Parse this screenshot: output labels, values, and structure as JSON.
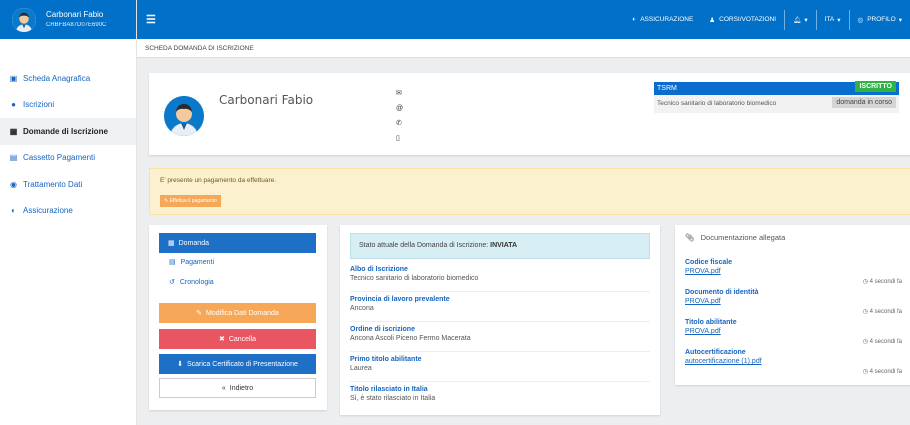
{
  "user": {
    "name": "Carbonari Fabio",
    "code": "CRBFBA87D07E690C"
  },
  "sidebar": {
    "items": [
      {
        "label": "Scheda Anagrafica",
        "icon": "id-card-icon"
      },
      {
        "label": "Iscrizioni",
        "icon": "user-icon"
      },
      {
        "label": "Domande di Iscrizione",
        "icon": "calendar-icon",
        "active": true
      },
      {
        "label": "Cassetto Pagamenti",
        "icon": "file-icon"
      },
      {
        "label": "Trattamento Dati",
        "icon": "eye-icon"
      },
      {
        "label": "Assicurazione",
        "icon": "shield-icon"
      }
    ]
  },
  "topbar": {
    "assicurazione": "ASSICURAZIONE",
    "corsi": "CORSI/VOTAZIONI",
    "language": "ITA",
    "profilo": "PROFILO"
  },
  "breadcrumb": "SCHEDA DOMANDA DI ISCRIZIONE",
  "profile": {
    "name": "Carbonari Fabio",
    "profession_code": "TSRM",
    "profession": "Tecnico sanitario di laboratorio biomedico",
    "status_badge": "ISCRITTO",
    "request_badge": "domanda in corso"
  },
  "alert": {
    "message": "E' presente un pagamento da effettuare.",
    "button": "Effettua il pagamento"
  },
  "left_menu": {
    "domanda": "Domanda",
    "pagamenti": "Pagamenti",
    "cronologia": "Cronologia",
    "modifica": "Modifica Dati Domanda",
    "cancella": "Cancella",
    "scarica": "Scarica Certificato di Presentazione",
    "indietro": "Indietro"
  },
  "details": {
    "status_prefix": "Stato attuale della Domanda di Iscrizione:",
    "status_value": "INVIATA",
    "fields": [
      {
        "label": "Albo di Iscrizione",
        "value": "Tecnico sanitario di laboratorio biomedico"
      },
      {
        "label": "Provincia di lavoro prevalente",
        "value": "Ancona"
      },
      {
        "label": "Ordine di iscrizione",
        "value": "Ancona Ascoli Piceno Fermo Macerata"
      },
      {
        "label": "Primo titolo abilitante",
        "value": "Laurea"
      },
      {
        "label": "Titolo rilasciato in Italia",
        "value": "Sì, è stato rilasciato in Italia"
      }
    ]
  },
  "documents": {
    "header": "Documentazione allegata",
    "items": [
      {
        "title": "Codice fiscale",
        "file": "PROVA.pdf",
        "time": "4 secondi fa"
      },
      {
        "title": "Documento di identità",
        "file": "PROVA.pdf",
        "time": "4 secondi fa"
      },
      {
        "title": "Titolo abilitante",
        "file": "PROVA.pdf",
        "time": "4 secondi fa"
      },
      {
        "title": "Autocertificazione",
        "file": "autocertificazione (1).pdf",
        "time": "4 secondi fa"
      }
    ]
  },
  "colors": {
    "primary": "#0070c9",
    "success": "#2fb344",
    "warning": "#f6a858",
    "danger": "#ea5562"
  }
}
